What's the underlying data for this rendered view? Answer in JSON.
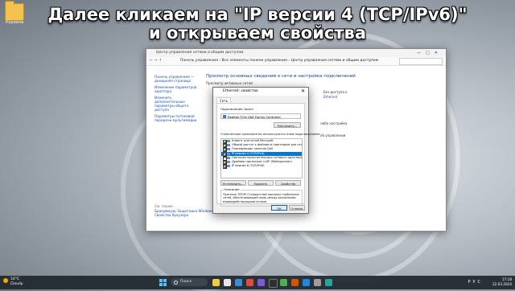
{
  "caption": {
    "line1": "Далее кликаем на \"IP версии 4 (TCP/IPv6)\"",
    "line2": "и открываем свойства"
  },
  "desktop": {
    "icon_label": "Корзина"
  },
  "window": {
    "title": "Центр управления сетями и общим доступом",
    "breadcrumb": "Панель управления  ›  Все элементы панели управления  ›  Центр управления сетями и общим доступом",
    "sidebar": [
      "Панель управления — домашняя страница",
      "Изменение параметров адаптера",
      "Изменить дополнительные параметры общего доступа",
      "Параметры потоковой передачи мультимедиа"
    ],
    "see_also_heading": "См. также",
    "see_also": [
      "Брандмауэр Защитника Windows",
      "Свойства браузера"
    ],
    "main_title": "Просмотр основных сведений о сети и настройка подключений",
    "main_sub": "Просмотр активных сетей",
    "frag_access": "Без доступа к",
    "frag_conn": "Ethernet",
    "frag_a": "либо настройка",
    "frag_b": "об управлении"
  },
  "dialog": {
    "title": "Ethernet: свойства",
    "close": "✕",
    "tab": "Сеть",
    "connect_via_label": "Подключение через:",
    "adapter": "Realtek PCIe GbE Family Controller",
    "configure_btn": "Настроить...",
    "components_label": "Отмеченные компоненты используются этим подключением:",
    "components": [
      {
        "label": "Клиент для сетей Microsoft",
        "checked": true,
        "selected": false
      },
      {
        "label": "Общий доступ к файлам и принтерам для сетей Mi",
        "checked": true,
        "selected": false
      },
      {
        "label": "Планировщик пакетов QoS",
        "checked": true,
        "selected": false
      },
      {
        "label": "IP версии 4 (TCP/IPv4)",
        "checked": true,
        "selected": true
      },
      {
        "label": "Протокол мультиплексора сетевого адаптера (Ма",
        "checked": false,
        "selected": false
      },
      {
        "label": "Драйвер протокола LLDP (Майкрософт)",
        "checked": true,
        "selected": false
      },
      {
        "label": "IP версии 6 (TCP/IPv6)",
        "checked": true,
        "selected": false
      }
    ],
    "install_btn": "Установить...",
    "remove_btn": "Удалить",
    "props_btn": "Свойства",
    "desc_label": "Описание",
    "desc_text": "Протокол TCP/IP. Стандартный протокол глобальных сетей, обеспечивающий связь между различными взаимодействующими сетями.",
    "ok_btn": "ОК",
    "cancel_btn": "Отмена"
  },
  "taskbar": {
    "weather_temp": "14°C",
    "weather_desc": "Cloudy",
    "search": "Поиск",
    "lang": "РУС",
    "time": "17:18",
    "date": "22.03.2024"
  }
}
